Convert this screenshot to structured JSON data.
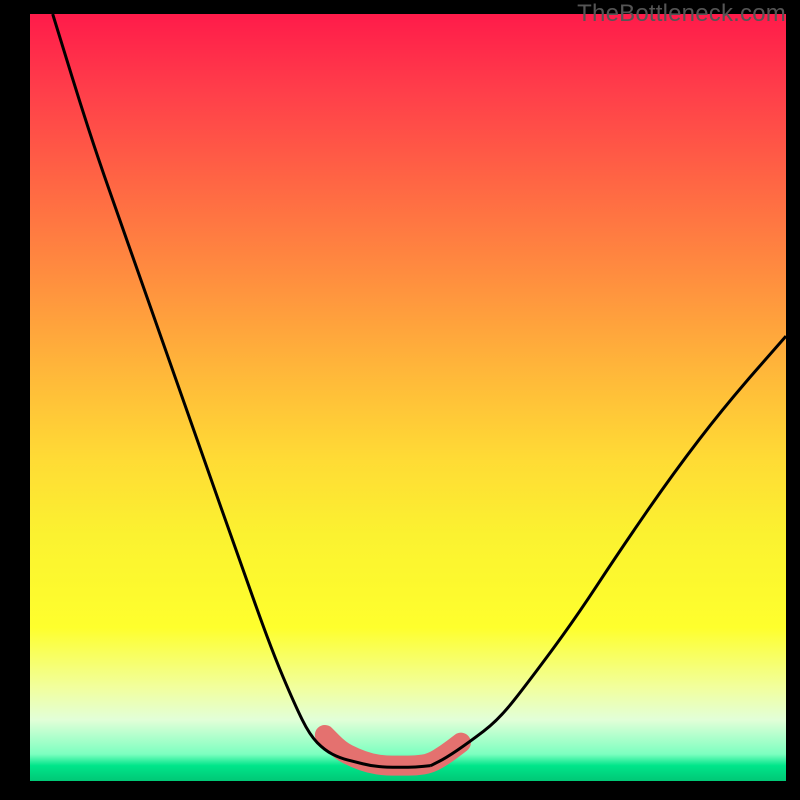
{
  "watermark": "TheBottleneck.com",
  "chart_data": {
    "type": "line",
    "title": "",
    "xlabel": "",
    "ylabel": "",
    "xlim": [
      0,
      100
    ],
    "ylim": [
      0,
      100
    ],
    "series": [
      {
        "name": "left-curve",
        "x": [
          3,
          8,
          13,
          18,
          23,
          28,
          32,
          35,
          37,
          39,
          41,
          43,
          45
        ],
        "y": [
          100,
          84,
          70,
          56,
          42,
          28,
          17,
          10,
          6,
          4,
          3,
          2.5,
          2
        ]
      },
      {
        "name": "right-curve",
        "x": [
          53,
          55,
          58,
          62,
          66,
          72,
          78,
          85,
          92,
          100
        ],
        "y": [
          2,
          3,
          5,
          8,
          13,
          21,
          30,
          40,
          49,
          58
        ]
      },
      {
        "name": "valley-floor",
        "x": [
          45,
          47,
          49,
          51,
          53
        ],
        "y": [
          2,
          1.8,
          1.8,
          1.8,
          2
        ]
      }
    ],
    "highlight": {
      "name": "pink-band",
      "x": [
        39,
        41,
        43,
        45,
        47,
        49,
        51,
        53,
        55,
        57
      ],
      "y": [
        6,
        4,
        3,
        2.3,
        2,
        2,
        2,
        2.3,
        3.5,
        5
      ]
    },
    "background_gradient": {
      "stops": [
        {
          "pos": 0,
          "color": "#ff1b4a"
        },
        {
          "pos": 50,
          "color": "#ffdb35"
        },
        {
          "pos": 92,
          "color": "#e2ffd8"
        },
        {
          "pos": 100,
          "color": "#00c876"
        }
      ]
    }
  }
}
